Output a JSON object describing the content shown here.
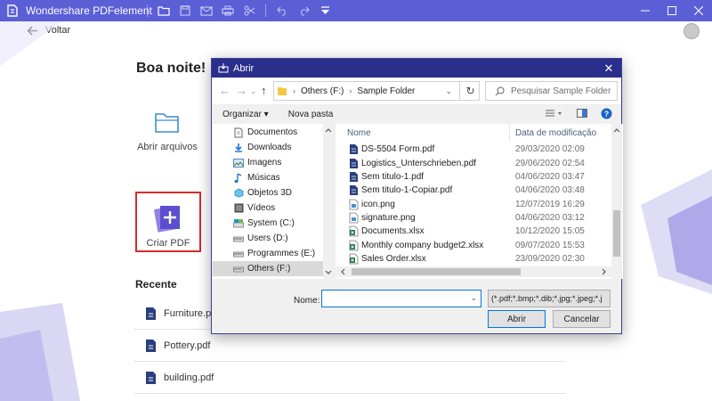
{
  "app": {
    "title": "Wondershare PDFelement"
  },
  "page": {
    "back_label": "Voltar",
    "greeting": "Boa noite!",
    "open_files_label": "Abrir arquivos",
    "create_pdf_label": "Criar PDF",
    "recent_title": "Recente",
    "recent_files": [
      {
        "name": "Furniture.pdf"
      },
      {
        "name": "Pottery.pdf"
      },
      {
        "name": "building.pdf"
      }
    ]
  },
  "dialog": {
    "title": "Abrir",
    "breadcrumb": [
      "Others (F:)",
      "Sample Folder"
    ],
    "search_placeholder": "Pesquisar Sample Folder",
    "organize_label": "Organizar",
    "new_folder_label": "Nova pasta",
    "nav_items": [
      {
        "label": "Documentos",
        "icon": "documents-icon"
      },
      {
        "label": "Downloads",
        "icon": "downloads-icon"
      },
      {
        "label": "Imagens",
        "icon": "pictures-icon"
      },
      {
        "label": "Músicas",
        "icon": "music-icon"
      },
      {
        "label": "Objetos 3D",
        "icon": "3d-objects-icon"
      },
      {
        "label": "Vídeos",
        "icon": "videos-icon"
      },
      {
        "label": "System (C:)",
        "icon": "drive-icon"
      },
      {
        "label": "Users (D:)",
        "icon": "drive-icon"
      },
      {
        "label": "Programmes (E:)",
        "icon": "drive-icon"
      },
      {
        "label": "Others (F:)",
        "icon": "drive-icon",
        "selected": true
      }
    ],
    "columns": {
      "name": "Nome",
      "date": "Data de modificação"
    },
    "files": [
      {
        "name": "DS-5504 Form.pdf",
        "date": "29/03/2020 02:09",
        "type": "pdf"
      },
      {
        "name": "Logistics_Unterschrieben.pdf",
        "date": "29/06/2020 02:54",
        "type": "pdf"
      },
      {
        "name": "Sem titulo-1.pdf",
        "date": "04/06/2020 03:47",
        "type": "pdf"
      },
      {
        "name": "Sem titulo-1-Copiar.pdf",
        "date": "04/06/2020 03:48",
        "type": "pdf"
      },
      {
        "name": "icon.png",
        "date": "12/07/2019 16:29",
        "type": "png"
      },
      {
        "name": "signature.png",
        "date": "04/06/2020 03:12",
        "type": "png"
      },
      {
        "name": "Documents.xlsx",
        "date": "10/12/2020 15:05",
        "type": "xlsx"
      },
      {
        "name": "Monthly company budget2.xlsx",
        "date": "09/07/2020 15:53",
        "type": "xlsx"
      },
      {
        "name": "Sales Order.xlsx",
        "date": "23/09/2020 02:30",
        "type": "xlsx"
      }
    ],
    "filename_label": "Nome:",
    "filename_value": "",
    "file_type_filter": "(*.pdf;*.bmp;*.dib;*.jpg;*.jpeg;*.j",
    "open_button": "Abrir",
    "cancel_button": "Cancelar"
  },
  "colors": {
    "app_titlebar": "#5b5fd6",
    "dialog_titlebar": "#2b2f8c",
    "highlight_border": "#d62b2b",
    "pdf_icon": "#2a3f7d",
    "xlsx_icon": "#1f7244"
  }
}
